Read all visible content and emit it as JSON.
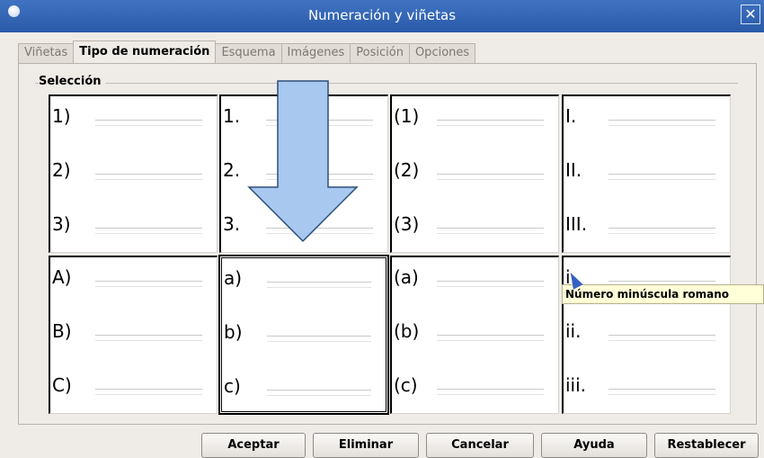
{
  "window": {
    "title": "Numeración y viñetas",
    "close_glyph": "✕",
    "icon": "app-icon"
  },
  "tabs": [
    {
      "label": "Viñetas",
      "active": false
    },
    {
      "label": "Tipo de numeración",
      "active": true
    },
    {
      "label": "Esquema",
      "active": false
    },
    {
      "label": "Imágenes",
      "active": false
    },
    {
      "label": "Posición",
      "active": false
    },
    {
      "label": "Opciones",
      "active": false
    }
  ],
  "section": {
    "label": "Selección"
  },
  "styles": [
    {
      "items": [
        "1)",
        "2)",
        "3)"
      ]
    },
    {
      "items": [
        "1.",
        "2.",
        "3."
      ]
    },
    {
      "items": [
        "(1)",
        "(2)",
        "(3)"
      ]
    },
    {
      "items": [
        "I.",
        "II.",
        "III."
      ]
    },
    {
      "items": [
        "A)",
        "B)",
        "C)"
      ]
    },
    {
      "items": [
        "a)",
        "b)",
        "c)"
      ],
      "selected": true
    },
    {
      "items": [
        "(a)",
        "(b)",
        "(c)"
      ]
    },
    {
      "items": [
        "i.",
        "ii.",
        "iii."
      ]
    }
  ],
  "tooltip": {
    "text": "Número minúscula romano"
  },
  "buttons": [
    {
      "label": "Aceptar"
    },
    {
      "label": "Eliminar"
    },
    {
      "label": "Cancelar"
    },
    {
      "label": "Ayuda"
    },
    {
      "label": "Restablecer"
    }
  ],
  "colors": {
    "titlebar": "#3f73c2",
    "arrow_fill": "#a8c8f0",
    "tooltip_bg": "#ffffd8"
  }
}
